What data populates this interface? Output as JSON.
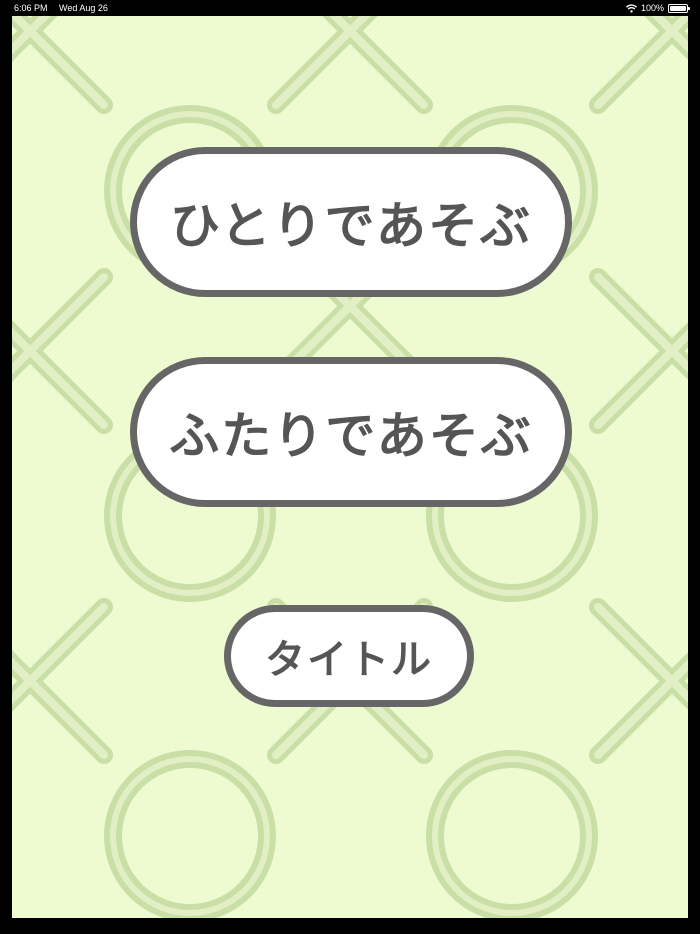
{
  "status_bar": {
    "time": "6:06 PM",
    "date": "Wed Aug 26",
    "battery": "100%",
    "wifi_icon": "wifi-icon",
    "battery_icon": "battery-icon"
  },
  "menu": {
    "single_player": "ひとりであそぶ",
    "two_player": "ふたりであそぶ",
    "title": "タイトル"
  },
  "colors": {
    "background": "#eefbd0",
    "pattern": "#c9dfa6",
    "button_fill": "#ffffff",
    "button_border": "#666666",
    "button_text": "#555555"
  }
}
